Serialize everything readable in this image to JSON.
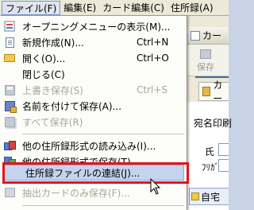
{
  "menubar": {
    "items": [
      {
        "label": "ファイル(F)",
        "active": true
      },
      {
        "label": "編集(E)"
      },
      {
        "label": "カード編集(C)"
      },
      {
        "label": "住所録(A)"
      }
    ]
  },
  "file_menu": {
    "items": [
      {
        "label": "オープニングメニューの表示(M)...",
        "icon": "opening-menu-icon",
        "shortcut": "",
        "enabled": true
      },
      {
        "label": "新規作成(N)...",
        "icon": "new-document-icon",
        "shortcut": "Ctrl+N",
        "enabled": true
      },
      {
        "label": "開く(O)...",
        "icon": "open-folder-icon",
        "shortcut": "Ctrl+O",
        "enabled": true
      },
      {
        "label": "閉じる(C)",
        "icon": "",
        "shortcut": "",
        "enabled": true
      },
      {
        "label": "上書き保存(S)",
        "icon": "save-disk-icon",
        "shortcut": "Ctrl+S",
        "enabled": false
      },
      {
        "label": "名前を付けて保存(A)...",
        "icon": "save-as-icon",
        "shortcut": "",
        "enabled": true
      },
      {
        "label": "すべて保存(R)",
        "icon": "save-all-icon",
        "shortcut": "",
        "enabled": false
      },
      {
        "label": "他の住所録形式の読み込み(I)...",
        "icon": "import-icon",
        "shortcut": "",
        "enabled": true
      },
      {
        "label": "他の住所録形式で保存(T)...",
        "icon": "export-icon",
        "shortcut": "",
        "enabled": true
      },
      {
        "label": "住所録ファイルの連結(J)...",
        "icon": "",
        "shortcut": "",
        "enabled": true,
        "highlighted": true
      },
      {
        "label": "抽出カードのみ保存(F)...",
        "icon": "extract-save-icon",
        "shortcut": "",
        "enabled": false
      }
    ]
  },
  "background_window": {
    "title": "カー",
    "toolbar_save": "保存",
    "tab_label": "カー",
    "text_line1": "宛名印刷",
    "text_name": "氏 名",
    "text_furigana": "ﾌﾘｶﾞﾅ",
    "bottom_tab": "自宅"
  },
  "colors": {
    "highlight_frame": "#e4141b",
    "menu_highlight": "#c5d4ee",
    "menubar_bg": "#ece9d8"
  }
}
